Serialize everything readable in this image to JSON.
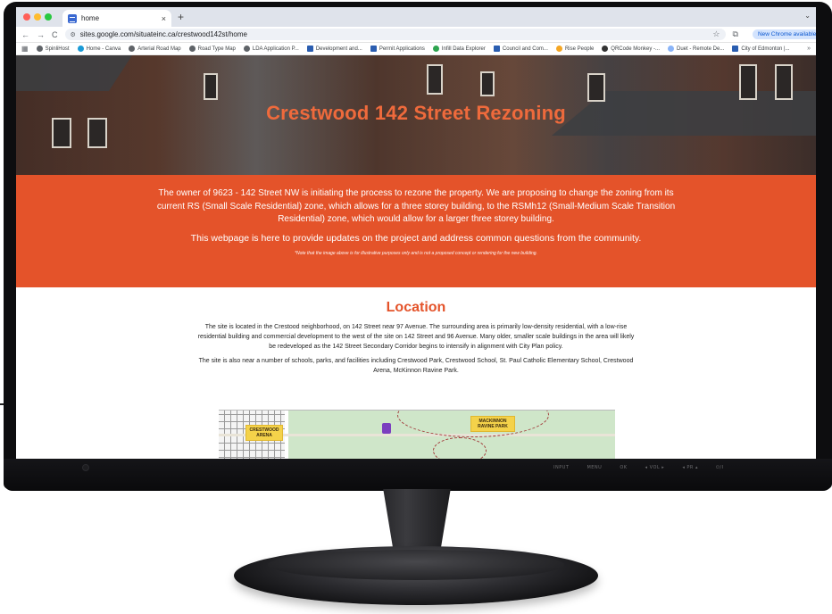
{
  "browser": {
    "tab_title": "home",
    "tab_close": "×",
    "new_tab": "+",
    "tab_menu": "⌄",
    "url": "sites.google.com/situateinc.ca/crestwood142st/home",
    "update_button": "New Chrome available",
    "back": "←",
    "forward": "→",
    "reload": "C",
    "bookmark_star": "☆",
    "bookmarks": [
      {
        "label": "SpinliHost",
        "color": "#5f6368"
      },
      {
        "label": "Home - Canva",
        "color": "#1a9ad6"
      },
      {
        "label": "Arterial Road Map",
        "color": "#5f6368"
      },
      {
        "label": "Road Type Map",
        "color": "#5f6368"
      },
      {
        "label": "LDA Application P...",
        "color": "#5f6368"
      },
      {
        "label": "Development and...",
        "color": "#2a5db0"
      },
      {
        "label": "Permit Applications",
        "color": "#2a5db0"
      },
      {
        "label": "Infill Data Explorer",
        "color": "#2ea44f"
      },
      {
        "label": "Council and Com...",
        "color": "#2a5db0"
      },
      {
        "label": "Rise People",
        "color": "#f5a623"
      },
      {
        "label": "QRCode Monkey -...",
        "color": "#333333"
      },
      {
        "label": "Duet - Remote De...",
        "color": "#8ab4f8"
      },
      {
        "label": "City of Edmonton |...",
        "color": "#2a5db0"
      }
    ],
    "bookmarks_more": "»"
  },
  "hero": {
    "title": "Crestwood 142 Street Rezoning"
  },
  "intro": {
    "paragraph": "The owner of 9623 - 142 Street NW is initiating the process to rezone the property. We are proposing to change the zoning from its current RS (Small Scale Residential) zone, which allows for a three storey building, to the RSMh12 (Small-Medium Scale Transition Residential) zone, which would allow for a larger three storey building.",
    "purpose": "This webpage is here to provide updates on the project and address common questions from the community.",
    "note": "*Note that the image above is for illustrative purposes only and is not a proposed concept or rendering for the new building."
  },
  "location": {
    "title": "Location",
    "paragraph1": "The site is located in the Crestood neighborhood, on 142 Street near 97 Avenue. The surrounding area is primarily low-density residential, with a low-rise residential building and commercial development to the west of the site on 142 Street and 96 Avenue. Many older, smaller scale buildings in the area will likely be redeveloped as the 142 Street Secondary Corridor begins to intensify in alignment with City Plan policy.",
    "paragraph2": "The site is also near a number of schools, parks, and facilities including Crestwood Park, Crestwood School, St. Paul Catholic Elementary School, Crestwood Arena, McKinnon Ravine Park."
  },
  "map": {
    "label_arena": "CRESTWOOD ARENA",
    "label_park": "MACKINNON RAVINE PARK"
  },
  "monitor": {
    "controls": [
      "INPUT",
      "MENU",
      "OK",
      "◂ VOL ▸",
      "◂ PR ▴",
      "⏻/I"
    ]
  },
  "colors": {
    "accent": "#e4532a",
    "hero_title": "#ef6a3c"
  }
}
